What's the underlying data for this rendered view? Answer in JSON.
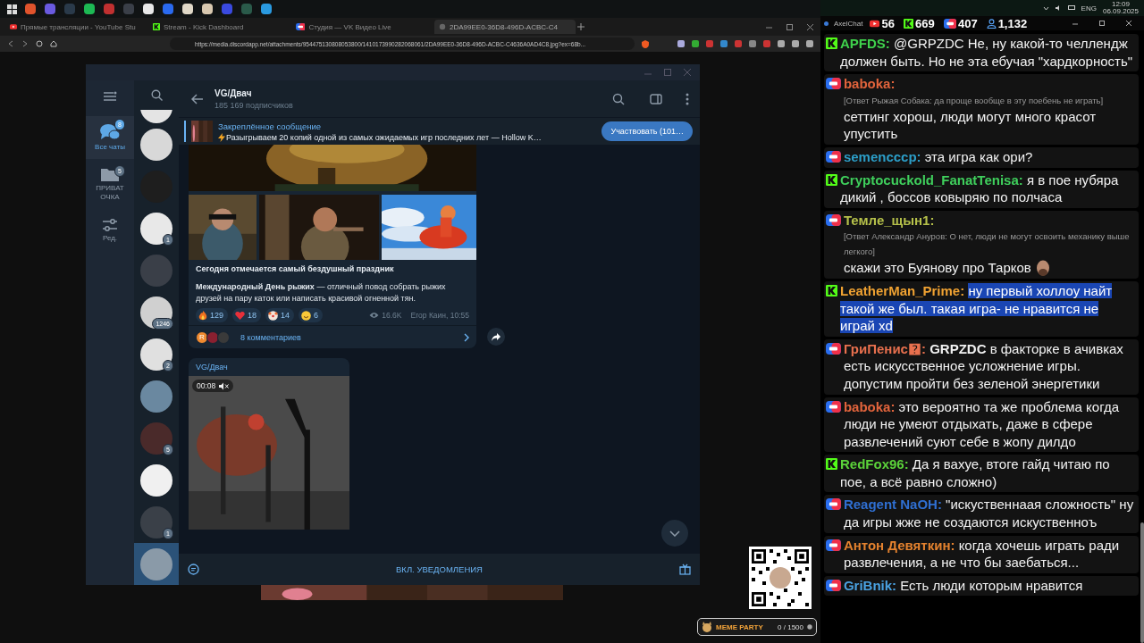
{
  "browser": {
    "tabs": [
      {
        "title": "Прямые трансляции - YouTube Stu",
        "kind": "youtube",
        "selected": false
      },
      {
        "title": "Stream - Kick Dashboard",
        "kind": "kick",
        "selected": false
      },
      {
        "title": "Студия — VK Видео Live",
        "kind": "vk",
        "selected": false
      },
      {
        "title": "2DA99EE0-36D8-496D-ACBC-C4",
        "kind": "web",
        "selected": true
      }
    ],
    "url": "https://media.discordapp.net/attachments/954475130808053800/1410173990282068061/2DA99EE0-36D8-496D-ACBC-C4636A0AD4C8.jpg?ex=68b..."
  },
  "telegram": {
    "folders": [
      {
        "label": "Все чаты",
        "badge": "8",
        "kind": "chats",
        "selected": true
      },
      {
        "label": "ПРИВАТ ОЧКА",
        "badge": "5",
        "kind": "folder",
        "selected": false
      },
      {
        "label": "Ред.",
        "kind": "edit",
        "selected": false
      }
    ],
    "chats": [
      {
        "selected": false
      },
      {
        "selected": false
      },
      {
        "badge": "1",
        "selected": false
      },
      {
        "selected": false
      },
      {
        "badge": "1246",
        "selected": false
      },
      {
        "badge": "2",
        "selected": false
      },
      {
        "selected": false
      },
      {
        "badge": "5",
        "selected": false
      },
      {
        "selected": false
      },
      {
        "badge": "1",
        "selected": false
      },
      {
        "selected": true
      }
    ],
    "channel": {
      "title": "VG/Двач",
      "subscribers": "185 169 подписчиков"
    },
    "pinned": {
      "title": "Закреплённое сообщение",
      "text": "Разыгрываем 20 копий одной из самых ожидаемых игр последних лет — Hollow K…",
      "button": "Участвовать (101…"
    },
    "post": {
      "title": "Сегодня отмечается самый бездушный праздник",
      "body": "**Международный День рыжих** — отличный повод собрать рыжих друзей на пару каток или написать красивой огненной тян.",
      "reactions": [
        {
          "kind": "fire",
          "count": "129"
        },
        {
          "kind": "heart",
          "count": "18"
        },
        {
          "kind": "clown",
          "count": "14"
        },
        {
          "kind": "smile",
          "count": "6"
        }
      ],
      "views": "16.6K",
      "signature": "Егор Каин, 10:55",
      "commenter_initial": "R",
      "comments": "8 комментариев"
    },
    "video_post": {
      "channel": "VG/Двач",
      "duration": "00:08",
      "muted": true
    },
    "footer": {
      "action": "ВКЛ. УВЕДОМЛЕНИЯ"
    }
  },
  "chat": {
    "tray": {
      "language": "ENG",
      "time": "12:09",
      "date": "06.09.2025"
    },
    "app": "AxelChat",
    "counts": [
      {
        "kind": "youtube",
        "count": "56"
      },
      {
        "kind": "kick",
        "count": "669"
      },
      {
        "kind": "vk",
        "count": "407"
      },
      {
        "kind": "viewers",
        "count": "1,132"
      }
    ],
    "messages": [
      {
        "kind": "kick",
        "author": "APFDS:",
        "color": "#3fd24c",
        "text": "@GRPZDC Не, ну какой-то челлендж должен быть. Но не эта ебучая \"хардкорность\"",
        "highlighted": false
      },
      {
        "kind": "vk",
        "author": "baboka:",
        "color": "#e2643c",
        "reply": "[Ответ Рыжая Собака: да проще вообще в эту поебень не играть]",
        "text": "сеттинг хорош, люди могут много красот упустить",
        "highlighted": false
      },
      {
        "kind": "vk",
        "author": "semencccp:",
        "color": "#2c9fc9",
        "text": "эта игра как ори?",
        "highlighted": false
      },
      {
        "kind": "kick",
        "author": "Cryptocuckold_FanatTenisa:",
        "color": "#3fcf5c",
        "text": "я в пое нубяра дикий , боссов ковыряю по полчаса",
        "highlighted": false
      },
      {
        "kind": "vk",
        "author": "Темле_щын1:",
        "color": "#b5c04a",
        "reply": "[Ответ Александр Ануров: О нет, люди не могут освоить механику выше легкого]",
        "text": "скажи это Буянову про Тарков",
        "emote": true,
        "highlighted": false
      },
      {
        "kind": "kick",
        "author": "LeatherMan_Prime:",
        "color": "#f0a232",
        "text": "ну первый холлоу найт такой же был. такая игра- не нравится не играй xd",
        "highlighted": true
      },
      {
        "kind": "vk",
        "author": "ГриПенис🯄:",
        "color": "#e8704e",
        "text": "**GRPZDC** в факторке в ачивках есть искусственное усложнение игры. допустим пройти без зеленой энергетики",
        "highlighted": false
      },
      {
        "kind": "vk",
        "author": "baboka:",
        "color": "#e2643c",
        "text": "это вероятно та же проблема когда люди не умеют отдыхать, даже в сфере развлечений суют себе в жопу дилдо",
        "highlighted": false
      },
      {
        "kind": "kick",
        "author": "RedFox96:",
        "color": "#5bd23a",
        "text": "Да я вахуе, втоге гайд читаю по пое, а всё равно сложно)",
        "highlighted": false
      },
      {
        "kind": "vk",
        "author": "Reagent NaOH:",
        "color": "#2f6fd2",
        "text": "\"искуственнаая сложность\" ну да игры жже не создаются искуственноъ",
        "highlighted": false
      },
      {
        "kind": "vk",
        "author": "Антон Девяткин:",
        "color": "#e4822e",
        "text": "когда хочешь играть ради развлечения, а не что бы заебаться...",
        "highlighted": false
      },
      {
        "kind": "vk",
        "author": "GriBnik:",
        "color": "#4aa2e2",
        "text": "Есть люди которым нравится",
        "highlighted": false
      }
    ]
  },
  "overlay": {
    "widget_title": "MEME PARTY",
    "widget_counter": "0 / 1500"
  }
}
